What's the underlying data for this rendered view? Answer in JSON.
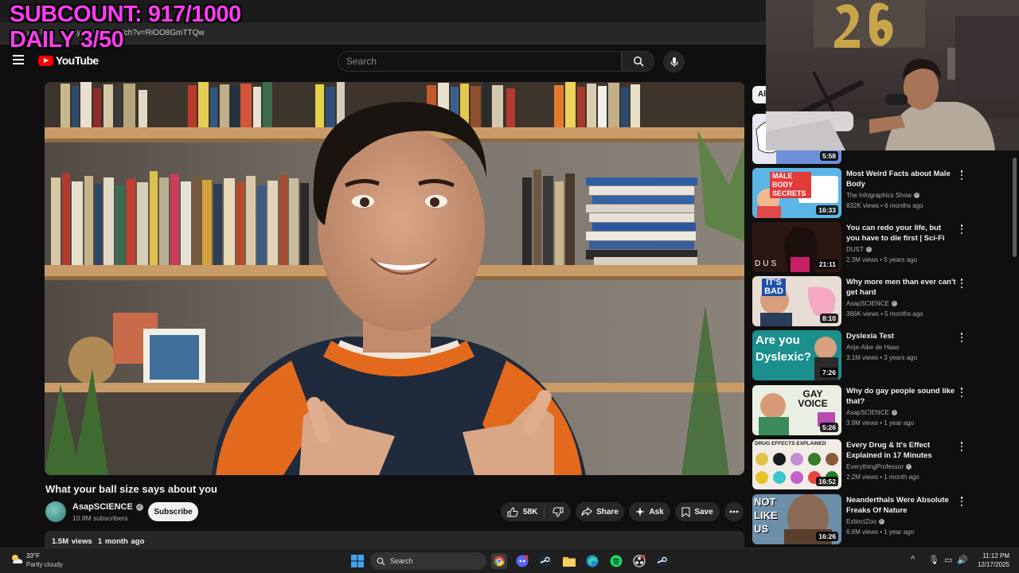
{
  "overlay": {
    "line1": "SUBCOUNT: 917/1000",
    "line2": "DAILY 3/50"
  },
  "browser": {
    "url": "...yo...e....n/watch?v=RiOO8GmTTQw"
  },
  "header": {
    "logo_text": "YouTube",
    "search_placeholder": "Search"
  },
  "video": {
    "title": "What your ball size says about you",
    "channel": "AsapSCIENCE",
    "subscribers": "10.8M subscribers",
    "subscribe_label": "Subscribe",
    "likes": "58K",
    "share_label": "Share",
    "ask_label": "Ask",
    "save_label": "Save",
    "views": "1.5M views",
    "age": "1 month ago"
  },
  "sidebar": {
    "chip_label": "Al",
    "items": [
      {
        "title": "",
        "channel": "",
        "meta": "",
        "duration": "5:58"
      },
      {
        "title": "Most Weird Facts about Male Body",
        "channel": "The Infographics Show",
        "meta": "832K views • 6 months ago",
        "duration": "16:33"
      },
      {
        "title": "You can redo your life, but you have to die first | Sci-Fi Short ...",
        "channel": "DUST",
        "meta": "2.3M views • 5 years ago",
        "duration": "21:11"
      },
      {
        "title": "Why more men than ever can't get hard",
        "channel": "AsapSCIENCE",
        "meta": "366K views • 5 months ago",
        "duration": "8:10"
      },
      {
        "title": "Dyslexia Test",
        "channel": "Arije-Aike de Haas",
        "meta": "3.1M views • 3 years ago",
        "duration": "7:26"
      },
      {
        "title": "Why do gay people sound like that?",
        "channel": "AsapSCIENCE",
        "meta": "3.9M views • 1 year ago",
        "duration": "5:26"
      },
      {
        "title": "Every Drug & It's Effect Explained in 17 Minutes",
        "channel": "EverythingProfessor",
        "meta": "2.2M views • 1 month ago",
        "duration": "16:52"
      },
      {
        "title": "Neanderthals Were Absolute Freaks Of Nature",
        "channel": "ExtinctZoo",
        "meta": "6.6M views • 1 year ago",
        "duration": "16:26"
      }
    ],
    "thumb_text": {
      "male_body": "MALE BODY SECRETS",
      "dust": "DUS",
      "its_bad": "IT'S BAD",
      "dyslexic": "Are you Dyslexic?",
      "gay_voice": "GAY VOICE",
      "drug": "DRUG EFFECTS EXPLAINED",
      "not_like_us": "NOT LIKE US"
    }
  },
  "taskbar": {
    "temperature": "33°F",
    "weather": "Partly cloudy",
    "search_label": "Search",
    "time": "11:12 PM",
    "date": "12/17/2025"
  },
  "colors": {
    "background": "#0f0f0f",
    "overlay": "#ff3df0",
    "brand_red": "#ff0000"
  }
}
